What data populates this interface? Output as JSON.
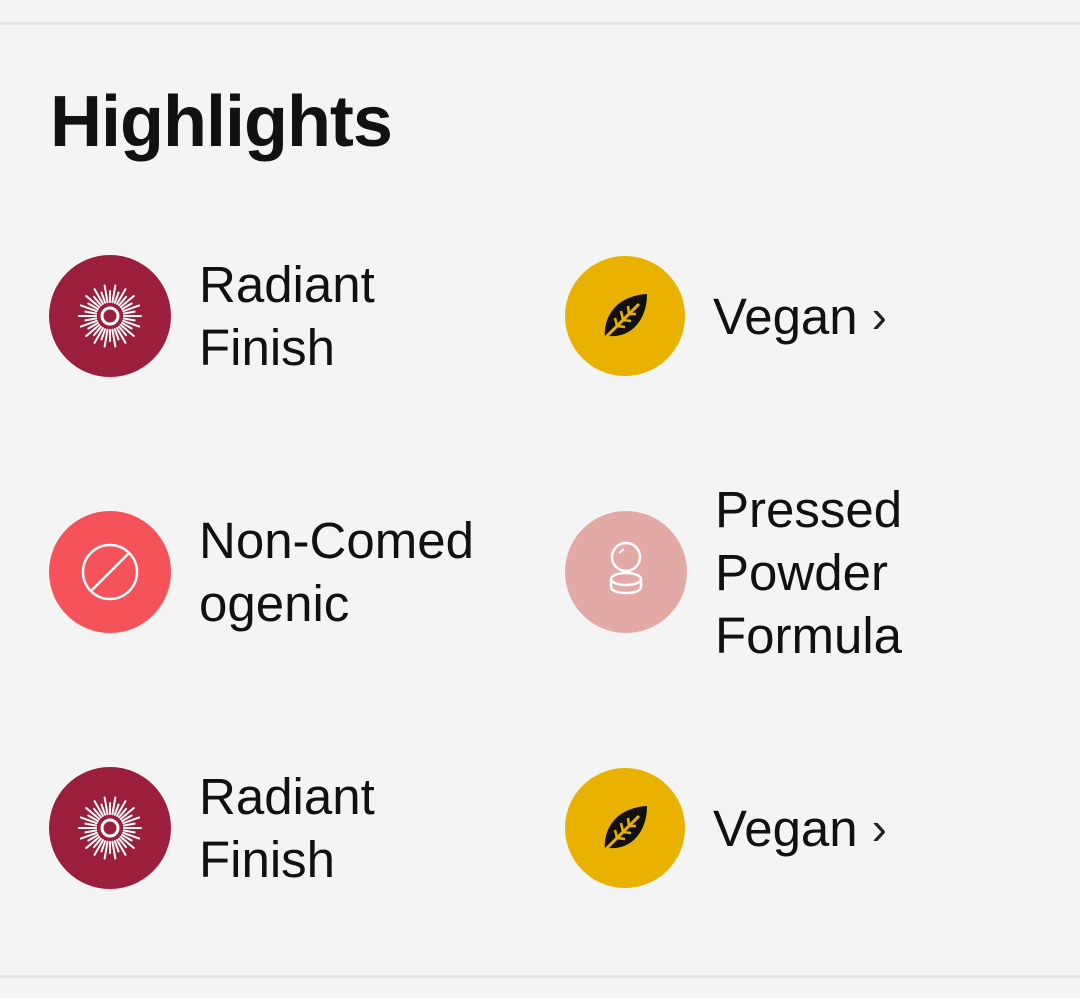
{
  "section": {
    "title": "Highlights"
  },
  "highlights": [
    {
      "label": "Radiant\nFinish",
      "icon": "radiant-icon",
      "color": "#9b1e3c",
      "has_chevron": false
    },
    {
      "label": "Vegan",
      "icon": "leaf-icon",
      "color": "#e9b100",
      "has_chevron": true,
      "chevron": "›"
    },
    {
      "label": "Non-Comed\nogenic",
      "icon": "non-comedogenic-icon",
      "color": "#f55359",
      "has_chevron": false
    },
    {
      "label": "Pressed\nPowder\nFormula",
      "icon": "pressed-powder-icon",
      "color": "#e3aaa5",
      "has_chevron": false
    },
    {
      "label": "Radiant\nFinish",
      "icon": "radiant-icon",
      "color": "#9b1e3c",
      "has_chevron": false
    },
    {
      "label": "Vegan",
      "icon": "leaf-icon",
      "color": "#e9b100",
      "has_chevron": true,
      "chevron": "›"
    }
  ]
}
